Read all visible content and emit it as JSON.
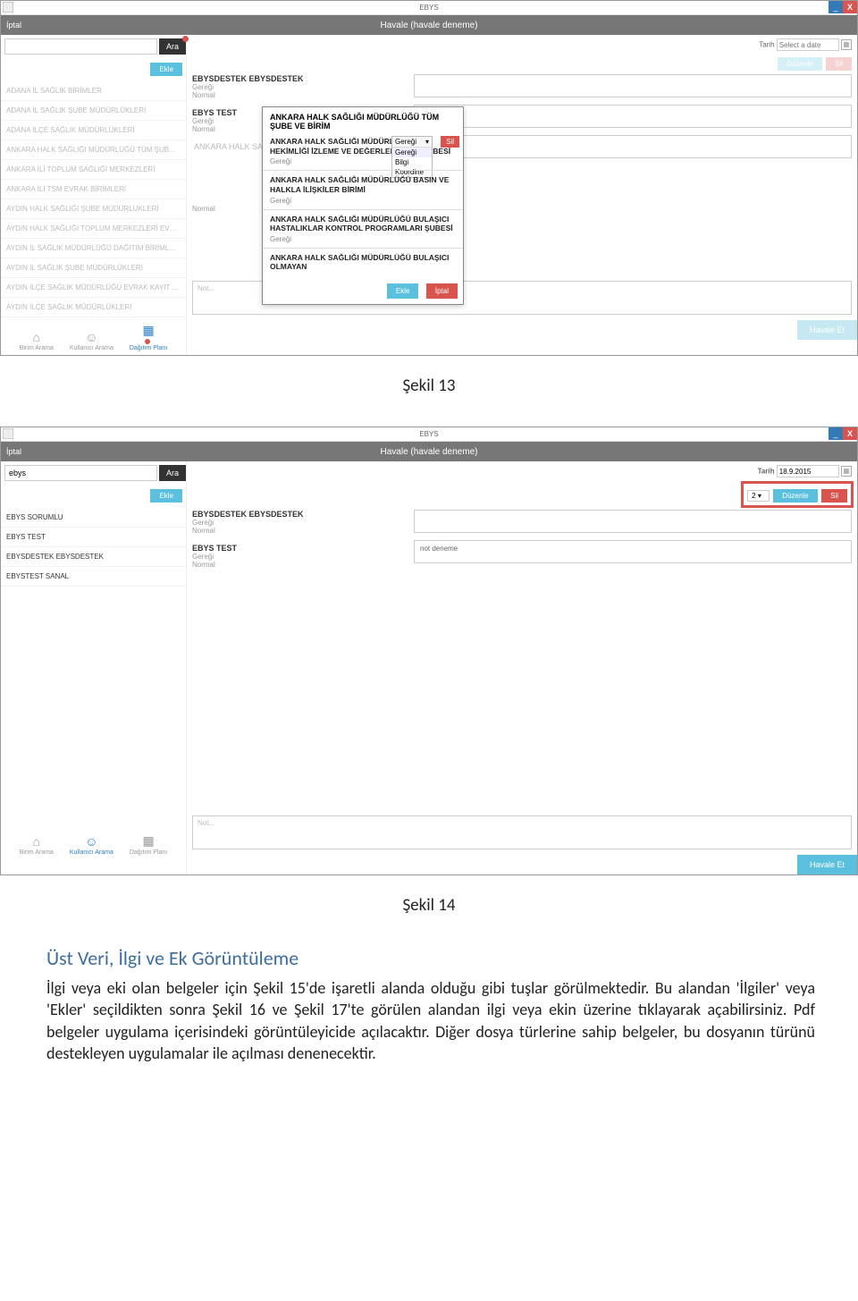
{
  "window": {
    "title": "EBYS",
    "subtitle": "Havale (havale deneme)",
    "iptal": "İptal"
  },
  "buttons": {
    "ara": "Ara",
    "ekle": "Ekle",
    "duzenle": "Düzenle",
    "sil": "Sil",
    "havale": "Havale Et",
    "iptal": "İptal"
  },
  "labels": {
    "tarih": "Tarih",
    "geregi": "Gereği",
    "normal": "Normal",
    "not": "Not...",
    "selectDate": "Select a date"
  },
  "fig1": {
    "searchValue": "",
    "units": [
      "ADANA İL SAĞLIK BİRİMLER",
      "ADANA İL SAĞLIK ŞUBE MÜDÜRLÜKLERİ",
      "ADANA İLÇE SAĞLIK MÜDÜRLÜKLERİ",
      "ANKARA HALK SAĞLIĞI MÜDÜRLÜĞÜ TÜM ŞUBE VE BİRİMLERİ",
      "ANKARA İLİ TOPLUM SAĞLIĞI MERKEZLERİ",
      "ANKARA İLİ TSM EVRAK BİRİMLERİ",
      "AYDIN HALK SAĞLIĞI ŞUBE MÜDÜRLÜKLERİ",
      "AYDIN HALK SAĞLIĞI TOPLUM MERKEZLERİ EVRAK KAYIT BİRİ...",
      "AYDIN İL SAĞLIK MÜDÜRLÜĞÜ DAĞITIM BİRİMLERİ",
      "AYDIN İL SAĞLIK ŞUBE MÜDÜRLÜKLERİ",
      "AYDIN İLÇE SAĞLIK MÜDÜRLÜĞÜ EVRAK KAYIT BİRİMLERİ",
      "AYDIN İLÇE SAĞLIK MÜDÜRLÜKLERİ"
    ],
    "tabs": {
      "birim": "Birim Arama",
      "kullanici": "Kullanıcı Arama",
      "dagitim": "Dağıtım Planı"
    },
    "entries": [
      {
        "name": "EBYSDESTEK EBYSDESTEK"
      },
      {
        "name": "EBYS TEST"
      },
      {
        "name": "ANKARA HALK SA"
      }
    ],
    "popup": {
      "title": "ANKARA HALK SAĞLIĞI MÜDÜRLÜĞÜ TÜM ŞUBE VE BİRİM",
      "dropdown": {
        "selected": "Gereği",
        "options": [
          "Gereği",
          "Bilgi",
          "Koordine"
        ]
      },
      "items": [
        "ANKARA HALK SAĞLIĞI MÜDÜRLÜĞÜ AİLE HEKİMLİĞİ İZLEME VE DEĞERLENDİRME ŞUBESİ",
        "ANKARA HALK SAĞLIĞI MÜDÜRLÜĞÜ BASIN VE HALKLA İLİŞKİLER BİRİMİ",
        "ANKARA HALK SAĞLIĞI MÜDÜRLÜĞÜ BULAŞICI HASTALIKLAR KONTROL PROGRAMLARI ŞUBESİ",
        "ANKARA HALK SAĞLIĞI MÜDÜRLÜĞÜ BULAŞICI OLMAYAN"
      ]
    }
  },
  "fig2": {
    "searchValue": "ebys",
    "date": "18.9.2015",
    "count": "2",
    "units": [
      "EBYS SORUMLU",
      "EBYS TEST",
      "EBYSDESTEK EBYSDESTEK",
      "EBYSTEST SANAL"
    ],
    "tabs": {
      "birim": "Birim Arama",
      "kullanici": "Kullanıcı Arama",
      "dagitim": "Dağıtım Planı"
    },
    "entries": [
      {
        "name": "EBYSDESTEK EBYSDESTEK"
      },
      {
        "name": "EBYS TEST"
      }
    ],
    "noteField": "not deneme"
  },
  "captions": {
    "s13": "Şekil 13",
    "s14": "Şekil 14"
  },
  "section": {
    "heading": "Üst Veri, İlgi ve Ek Görüntüleme",
    "para": "İlgi veya eki olan belgeler için Şekil 15'de işaretli alanda olduğu gibi tuşlar görülmektedir. Bu alandan 'İlgiler' veya 'Ekler' seçildikten sonra Şekil 16 ve Şekil 17'te görülen alandan ilgi veya ekin üzerine tıklayarak açabilirsiniz. Pdf belgeler uygulama içerisindeki görüntüleyicide açılacaktır. Diğer dosya türlerine sahip belgeler, bu dosyanın türünü destekleyen uygulamalar ile açılması denenecektir."
  }
}
